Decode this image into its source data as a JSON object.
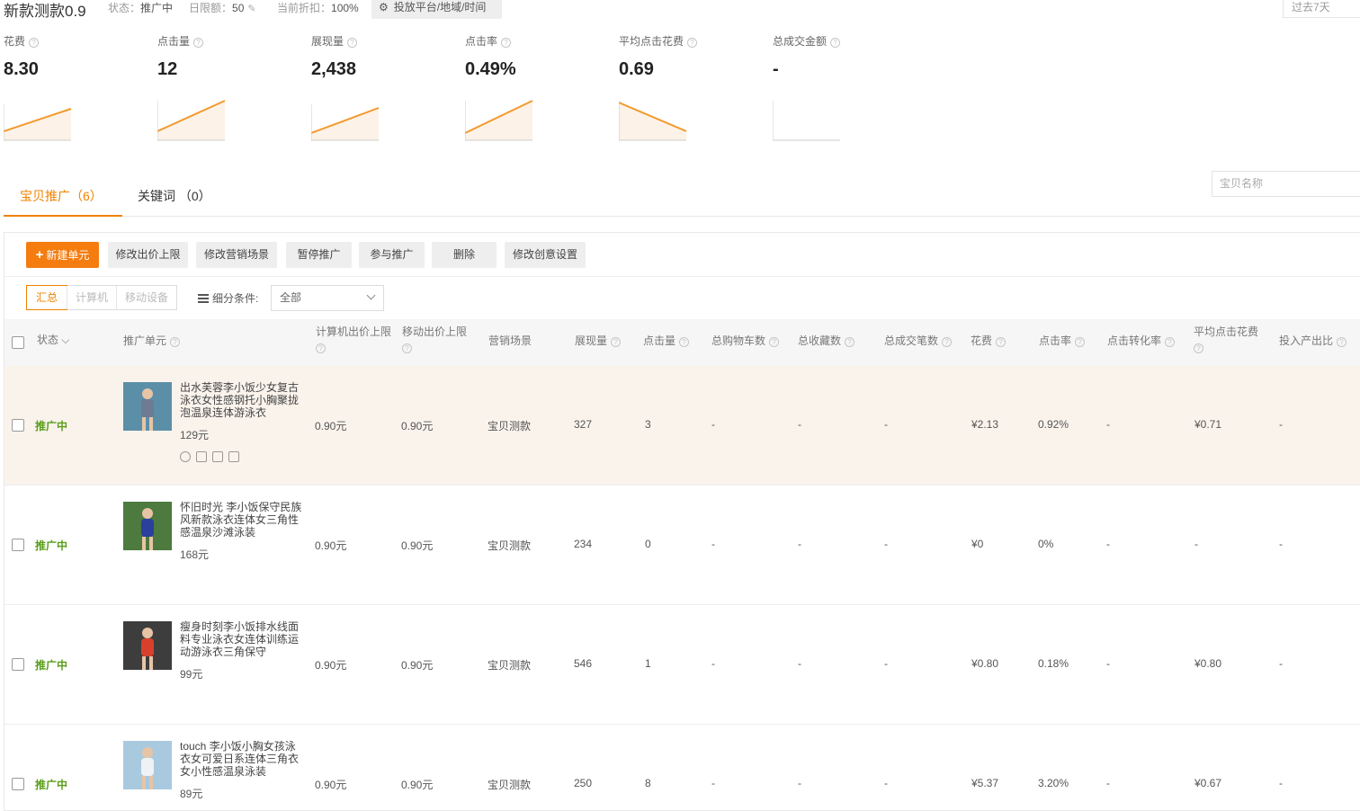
{
  "header": {
    "title": "新款测款0.9",
    "status_label": "状态：",
    "status_value": "推广中",
    "budget_label": "日限额：",
    "budget_value": "50",
    "discount_label": "当前折扣：",
    "discount_value": "100%",
    "platform_button": "投放平台/地域/时间",
    "date_range": "过去7天"
  },
  "metrics": [
    {
      "label": "花费",
      "value": "8.30",
      "trend": "up"
    },
    {
      "label": "点击量",
      "value": "12",
      "trend": "up"
    },
    {
      "label": "展现量",
      "value": "2,438",
      "trend": "up"
    },
    {
      "label": "点击率",
      "value": "0.49%",
      "trend": "up"
    },
    {
      "label": "平均点击花费",
      "value": "0.69",
      "trend": "down"
    },
    {
      "label": "总成交金额",
      "value": "-",
      "trend": "flat"
    }
  ],
  "tabs": {
    "promo": "宝贝推广（6）",
    "keywords": "关键词 （0）"
  },
  "search_placeholder": "宝贝名称",
  "toolbar": {
    "new_unit": "新建单元",
    "edit_bid": "修改出价上限",
    "edit_scene": "修改营销场景",
    "pause": "暂停推广",
    "join": "参与推广",
    "delete": "删除",
    "edit_creative": "修改创意设置"
  },
  "filter": {
    "summary": "汇总",
    "pc": "计算机",
    "mobile": "移动设备",
    "cond_label": "细分条件:",
    "cond_value": "全部"
  },
  "columns": {
    "status": "状态",
    "unit": "推广单元",
    "pc_bid": "计算机出价上限",
    "mobile_bid": "移动出价上限",
    "scene": "营销场景",
    "impressions": "展现量",
    "clicks": "点击量",
    "cart": "总购物车数",
    "fav": "总收藏数",
    "orders": "总成交笔数",
    "cost": "花费",
    "ctr": "点击率",
    "cvr": "点击转化率",
    "cpc": "平均点击花费",
    "roi": "投入产出比"
  },
  "rows": [
    {
      "status": "推广中",
      "name": "出水芙蓉李小饭少女复古泳衣女性感钢托小胸聚拢泡温泉连体游泳衣",
      "price": "129元",
      "pc_bid": "0.90元",
      "mobile_bid": "0.90元",
      "scene": "宝贝测款",
      "impressions": "327",
      "clicks": "3",
      "cart": "-",
      "fav": "-",
      "orders": "-",
      "cost": "¥2.13",
      "ctr": "0.92%",
      "cvr": "-",
      "cpc": "¥0.71",
      "roi": "-",
      "thumb_color": "#5b8fa8",
      "thumb_body": "#6e7b92"
    },
    {
      "status": "推广中",
      "name": "怀旧时光 李小饭保守民族风新款泳衣连体女三角性感温泉沙滩泳装",
      "price": "168元",
      "pc_bid": "0.90元",
      "mobile_bid": "0.90元",
      "scene": "宝贝测款",
      "impressions": "234",
      "clicks": "0",
      "cart": "-",
      "fav": "-",
      "orders": "-",
      "cost": "¥0",
      "ctr": "0%",
      "cvr": "-",
      "cpc": "-",
      "roi": "-",
      "thumb_color": "#4d7a3e",
      "thumb_body": "#2b3f9c"
    },
    {
      "status": "推广中",
      "name": "瘦身时刻李小饭排水线面料专业泳衣女连体训练运动游泳衣三角保守",
      "price": "99元",
      "pc_bid": "0.90元",
      "mobile_bid": "0.90元",
      "scene": "宝贝测款",
      "impressions": "546",
      "clicks": "1",
      "cart": "-",
      "fav": "-",
      "orders": "-",
      "cost": "¥0.80",
      "ctr": "0.18%",
      "cvr": "-",
      "cpc": "¥0.80",
      "roi": "-",
      "thumb_color": "#3d3d3d",
      "thumb_body": "#d9402b"
    },
    {
      "status": "推广中",
      "name": "touch 李小饭小胸女孩泳衣女可爱日系连体三角衣女小性感温泉泳装",
      "price": "89元",
      "pc_bid": "0.90元",
      "mobile_bid": "0.90元",
      "scene": "宝贝测款",
      "impressions": "250",
      "clicks": "8",
      "cart": "-",
      "fav": "-",
      "orders": "-",
      "cost": "¥5.37",
      "ctr": "3.20%",
      "cvr": "-",
      "cpc": "¥0.67",
      "roi": "-",
      "thumb_color": "#a9c9df",
      "thumb_body": "#eef2f4"
    }
  ]
}
